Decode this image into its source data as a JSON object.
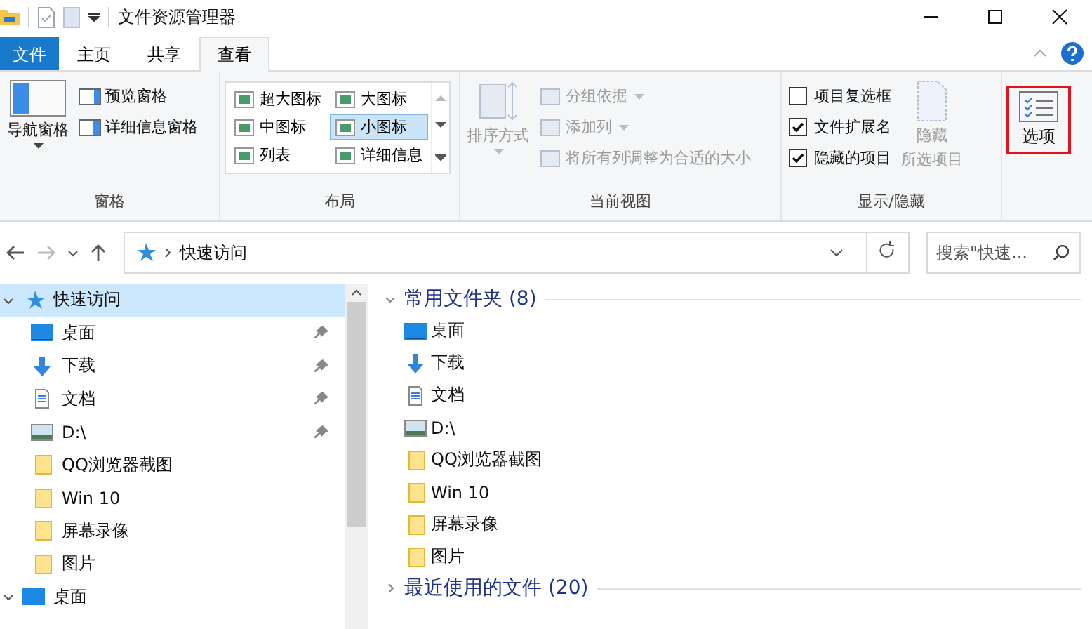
{
  "window": {
    "title": "文件资源管理器"
  },
  "tabs": [
    {
      "label": "文件",
      "kind": "file",
      "selected": false
    },
    {
      "label": "主页",
      "kind": "tab",
      "selected": false
    },
    {
      "label": "共享",
      "kind": "tab",
      "selected": false
    },
    {
      "label": "查看",
      "kind": "tab",
      "selected": true
    }
  ],
  "ribbon": {
    "panes": {
      "nav_pane": "导航窗格",
      "preview_pane": "预览窗格",
      "details_pane": "详细信息窗格",
      "group": "窗格"
    },
    "layout": {
      "items": [
        {
          "label": "超大图标",
          "selected": false
        },
        {
          "label": "大图标",
          "selected": false
        },
        {
          "label": "中图标",
          "selected": false
        },
        {
          "label": "小图标",
          "selected": true
        },
        {
          "label": "列表",
          "selected": false
        },
        {
          "label": "详细信息",
          "selected": false
        }
      ],
      "group": "布局"
    },
    "current_view": {
      "sort": "排序方式",
      "items": [
        {
          "label": "分组依据",
          "dropdown": true,
          "disabled": true
        },
        {
          "label": "添加列",
          "dropdown": true,
          "disabled": true
        },
        {
          "label": "将所有列调整为合适的大小",
          "dropdown": false,
          "disabled": true
        }
      ],
      "group": "当前视图"
    },
    "show_hide": {
      "checkboxes": [
        {
          "label": "项目复选框",
          "checked": false
        },
        {
          "label": "文件扩展名",
          "checked": true
        },
        {
          "label": "隐藏的项目",
          "checked": true
        }
      ],
      "hide_selected": [
        "隐藏",
        "所选项目"
      ],
      "group": "显示/隐藏"
    },
    "options": {
      "label": "选项",
      "highlighted": true
    }
  },
  "address": {
    "path": "快速访问",
    "search_placeholder": "搜索\"快速..."
  },
  "nav": [
    {
      "label": "快速访问",
      "kind": "star",
      "selected": true,
      "expanded": true,
      "children": [
        {
          "label": "桌面",
          "kind": "desktop",
          "pinned": true
        },
        {
          "label": "下载",
          "kind": "download",
          "pinned": true
        },
        {
          "label": "文档",
          "kind": "document",
          "pinned": true
        },
        {
          "label": "D:\\",
          "kind": "picture",
          "pinned": true
        },
        {
          "label": "QQ浏览器截图",
          "kind": "folder",
          "pinned": false
        },
        {
          "label": "Win 10",
          "kind": "folder",
          "pinned": false
        },
        {
          "label": "屏幕录像",
          "kind": "folder",
          "pinned": false
        },
        {
          "label": "图片",
          "kind": "folder",
          "pinned": false
        }
      ]
    },
    {
      "label": "桌面",
      "kind": "desktop",
      "selected": false,
      "expanded": true
    }
  ],
  "sections": [
    {
      "title": "常用文件夹 (8)",
      "expanded": true,
      "items": [
        {
          "label": "桌面",
          "kind": "desktop"
        },
        {
          "label": "下载",
          "kind": "download"
        },
        {
          "label": "文档",
          "kind": "document"
        },
        {
          "label": "D:\\",
          "kind": "picture"
        },
        {
          "label": "QQ浏览器截图",
          "kind": "folder"
        },
        {
          "label": "Win 10",
          "kind": "folder"
        },
        {
          "label": "屏幕录像",
          "kind": "folder"
        },
        {
          "label": "图片",
          "kind": "folder"
        }
      ]
    },
    {
      "title": "最近使用的文件 (20)",
      "expanded": false
    }
  ]
}
